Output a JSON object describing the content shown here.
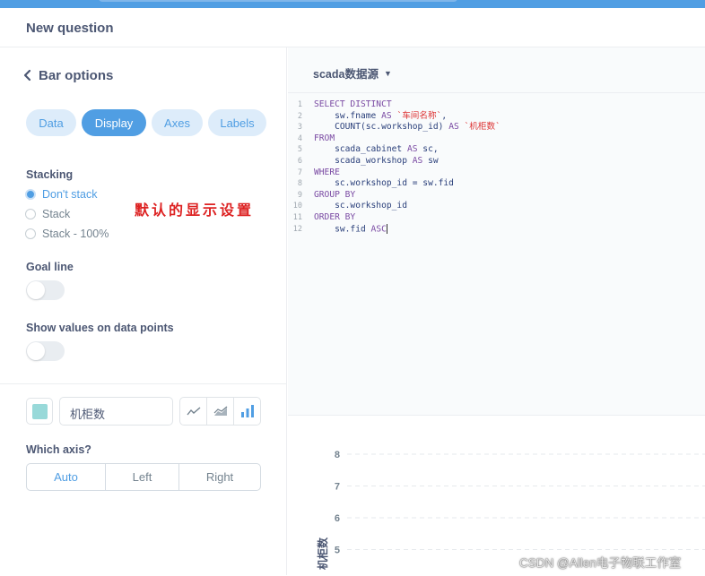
{
  "header": {
    "title": "New question"
  },
  "panel": {
    "back_label": "Bar options",
    "tabs": [
      {
        "label": "Data",
        "active": false
      },
      {
        "label": "Display",
        "active": true
      },
      {
        "label": "Axes",
        "active": false
      },
      {
        "label": "Labels",
        "active": false
      }
    ],
    "stacking": {
      "label": "Stacking",
      "options": [
        "Don't stack",
        "Stack",
        "Stack - 100%"
      ],
      "selected": "Don't stack"
    },
    "annotation": "默认的显示设置",
    "goal_line": {
      "label": "Goal line",
      "enabled": false
    },
    "show_values": {
      "label": "Show values on data points",
      "enabled": false
    },
    "series": {
      "color": "#98d9d9",
      "name": "机柜数",
      "display_types": [
        "line-icon",
        "area-icon",
        "bar-icon"
      ],
      "selected_type": "bar-icon"
    },
    "which_axis": {
      "label": "Which axis?",
      "options": [
        "Auto",
        "Left",
        "Right"
      ],
      "selected": "Auto"
    }
  },
  "editor": {
    "database": "scada数据源",
    "lines": [
      {
        "n": "1",
        "code": "SELECT DISTINCT"
      },
      {
        "n": "2",
        "code": "    sw.fname AS `车间名称`,"
      },
      {
        "n": "3",
        "code": "    COUNT(sc.workshop_id) AS `机柜数`"
      },
      {
        "n": "4",
        "code": "FROM"
      },
      {
        "n": "5",
        "code": "    scada_cabinet AS sc,"
      },
      {
        "n": "6",
        "code": "    scada_workshop AS sw"
      },
      {
        "n": "7",
        "code": "WHERE"
      },
      {
        "n": "8",
        "code": "    sc.workshop_id = sw.fid"
      },
      {
        "n": "9",
        "code": "GROUP BY"
      },
      {
        "n": "10",
        "code": "    sc.workshop_id"
      },
      {
        "n": "11",
        "code": "ORDER BY"
      },
      {
        "n": "12",
        "code": "    sw.fid ASC"
      }
    ]
  },
  "chart_data": {
    "type": "bar",
    "ylabel": "机柜数",
    "y_ticks": [
      8,
      7,
      6,
      5
    ],
    "grid": true,
    "series": [
      {
        "name": "机柜数",
        "values": []
      }
    ]
  },
  "watermark": "CSDN @Allen电子物联工作室",
  "colors": {
    "brand": "#509ee3",
    "text": "#4c5773",
    "muted": "#74838f"
  }
}
